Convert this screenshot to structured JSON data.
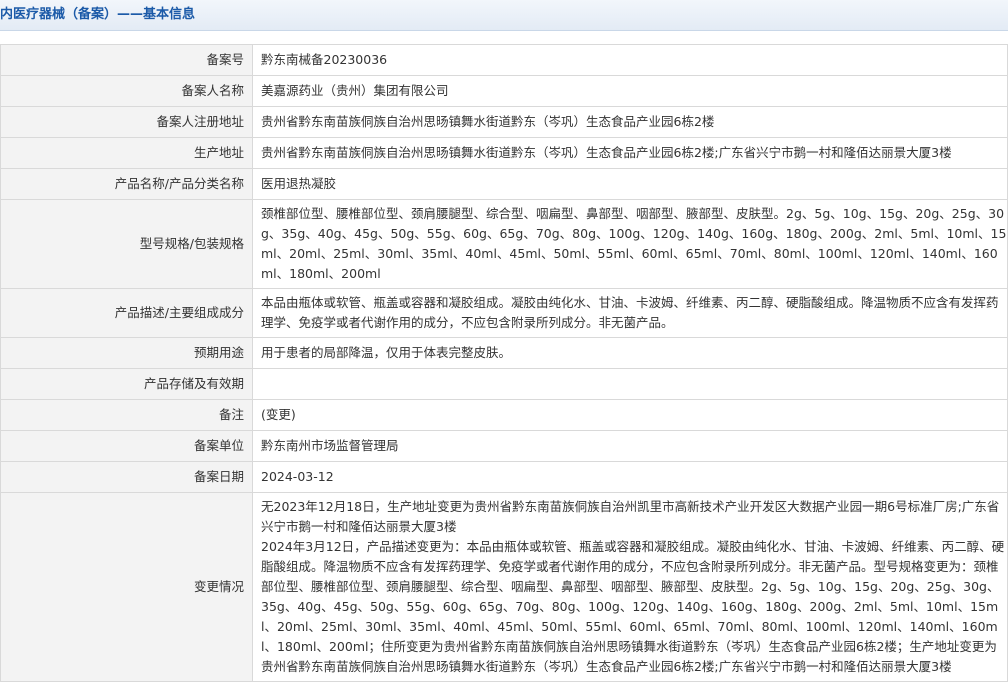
{
  "header": {
    "title": "内医疗器械（备案）——基本信息"
  },
  "rows": [
    {
      "label": "备案号",
      "value": "黔东南械备20230036"
    },
    {
      "label": "备案人名称",
      "value": "美嘉源药业（贵州）集团有限公司"
    },
    {
      "label": "备案人注册地址",
      "value": "贵州省黔东南苗族侗族自治州思旸镇舞水街道黔东（岑巩）生态食品产业园6栋2楼"
    },
    {
      "label": "生产地址",
      "value": "贵州省黔东南苗族侗族自治州思旸镇舞水街道黔东（岑巩）生态食品产业园6栋2楼;广东省兴宁市鹅一村和隆佰达丽景大厦3楼"
    },
    {
      "label": "产品名称/产品分类名称",
      "value": "医用退热凝胶"
    },
    {
      "label": "型号规格/包装规格",
      "value": "颈椎部位型、腰椎部位型、颈肩腰腿型、综合型、咽扁型、鼻部型、咽部型、腋部型、皮肤型。2g、5g、10g、15g、20g、25g、30g、35g、40g、45g、50g、55g、60g、65g、70g、80g、100g、120g、140g、160g、180g、200g、2ml、5ml、10ml、15ml、20ml、25ml、30ml、35ml、40ml、45ml、50ml、55ml、60ml、65ml、70ml、80ml、100ml、120ml、140ml、160ml、180ml、200ml"
    },
    {
      "label": "产品描述/主要组成成分",
      "value": "本品由瓶体或软管、瓶盖或容器和凝胶组成。凝胶由纯化水、甘油、卡波姆、纤维素、丙二醇、硬脂酸组成。降温物质不应含有发挥药理学、免疫学或者代谢作用的成分，不应包含附录所列成分。非无菌产品。"
    },
    {
      "label": "预期用途",
      "value": "用于患者的局部降温，仅用于体表完整皮肤。"
    },
    {
      "label": "产品存储及有效期",
      "value": ""
    },
    {
      "label": "备注",
      "value": "(变更)"
    },
    {
      "label": "备案单位",
      "value": "黔东南州市场监督管理局"
    },
    {
      "label": "备案日期",
      "value": "2024-03-12"
    },
    {
      "label": "变更情况",
      "value": "无2023年12月18日，生产地址变更为贵州省黔东南苗族侗族自治州凯里市高新技术产业开发区大数据产业园一期6号标准厂房;广东省兴宁市鹅一村和隆佰达丽景大厦3楼\n2024年3月12日，产品描述变更为：本品由瓶体或软管、瓶盖或容器和凝胶组成。凝胶由纯化水、甘油、卡波姆、纤维素、丙二醇、硬脂酸组成。降温物质不应含有发挥药理学、免疫学或者代谢作用的成分，不应包含附录所列成分。非无菌产品。型号规格变更为：颈椎部位型、腰椎部位型、颈肩腰腿型、综合型、咽扁型、鼻部型、咽部型、腋部型、皮肤型。2g、5g、10g、15g、20g、25g、30g、35g、40g、45g、50g、55g、60g、65g、70g、80g、100g、120g、140g、160g、180g、200g、2ml、5ml、10ml、15ml、20ml、25ml、30ml、35ml、40ml、45ml、50ml、55ml、60ml、65ml、70ml、80ml、100ml、120ml、140ml、160ml、180ml、200ml；住所变更为贵州省黔东南苗族侗族自治州思旸镇舞水街道黔东（岑巩）生态食品产业园6栋2楼；生产地址变更为贵州省黔东南苗族侗族自治州思旸镇舞水街道黔东（岑巩）生态食品产业园6栋2楼;广东省兴宁市鹅一村和隆佰达丽景大厦3楼"
    }
  ]
}
